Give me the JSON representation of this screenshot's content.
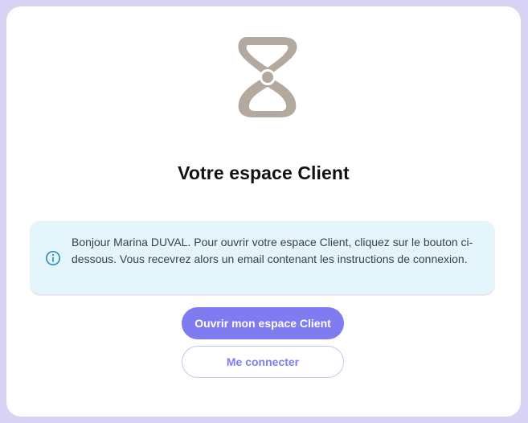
{
  "card": {
    "title": "Votre espace Client",
    "logo_icon": "brand-logo-icon"
  },
  "info": {
    "icon": "info-icon",
    "message": "Bonjour Marina DUVAL. Pour ouvrir votre espace Client, cliquez sur le bouton ci-dessous. Vous recevrez alors un email contenant les instructions de connexion."
  },
  "actions": {
    "open_label": "Ouvrir mon espace Client",
    "login_label": "Me connecter"
  },
  "colors": {
    "background": "#d6d3f4",
    "card": "#ffffff",
    "accent": "#7f7bf1",
    "info_background": "#e4f4fb",
    "info_icon": "#2f8fc0",
    "logo": "#b3a99f"
  }
}
